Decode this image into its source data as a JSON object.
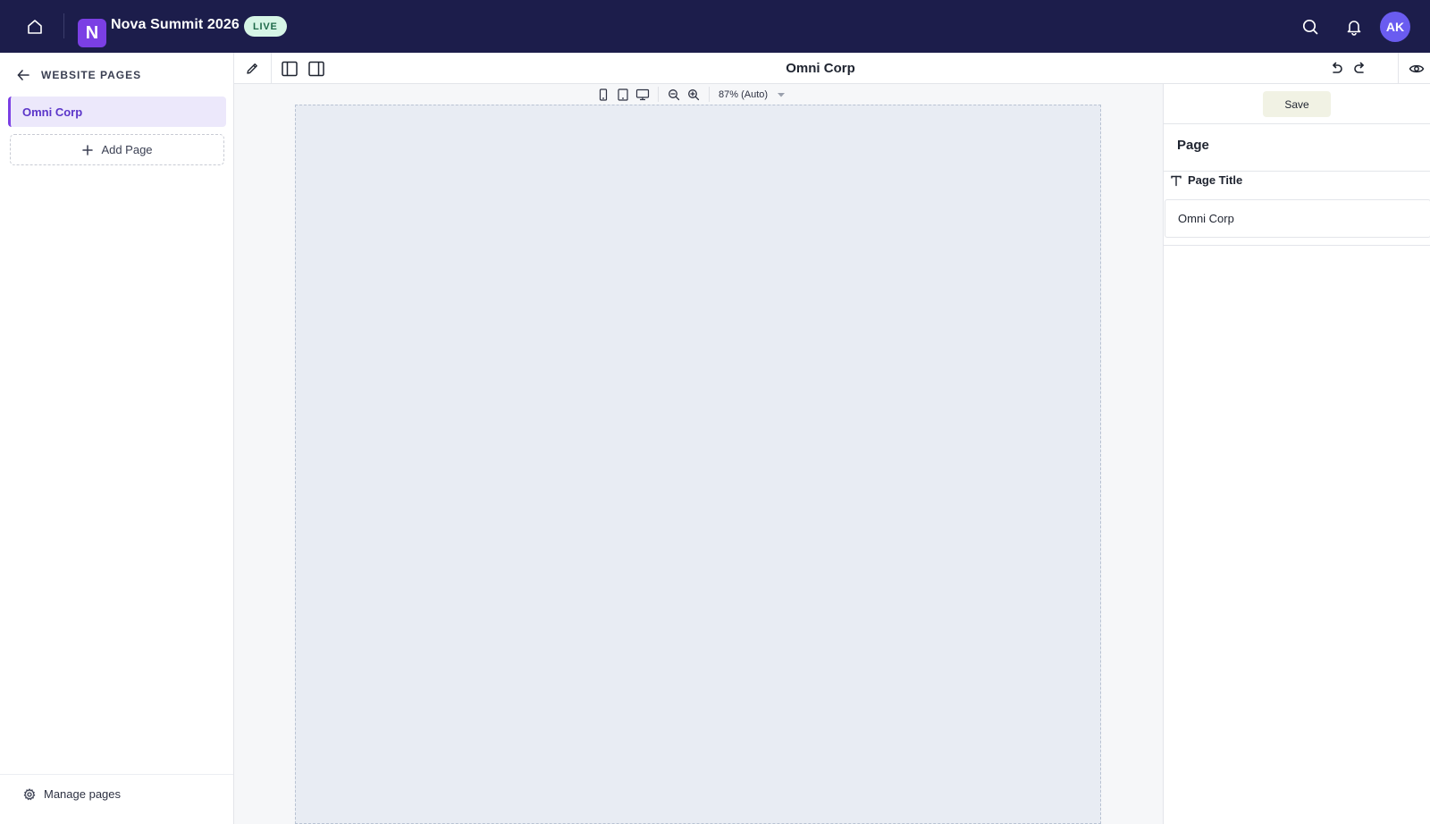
{
  "topbar": {
    "app_logo_letter": "N",
    "event_title": "Nova Summit 2026",
    "status_badge": "LIVE",
    "avatar_initials": "AK",
    "icons": [
      "home-icon",
      "search-icon",
      "bell-icon"
    ]
  },
  "sidebar": {
    "header_label": "WEBSITE PAGES",
    "pages": [
      {
        "label": "Omni Corp",
        "active": true
      }
    ],
    "add_page_label": "Add Page",
    "manage_pages_label": "Manage pages"
  },
  "toolbar": {
    "page_title": "Omni Corp",
    "icons": [
      "pencil-icon",
      "left-panel-icon",
      "right-panel-icon",
      "undo-icon",
      "redo-icon",
      "eye-icon"
    ]
  },
  "viewbar": {
    "devices": [
      "mobile-icon",
      "tablet-icon",
      "desktop-icon"
    ],
    "zoom_label": "87% (Auto)"
  },
  "right_panel": {
    "save_label": "Save",
    "section_heading": "Page",
    "field_label": "Page Title",
    "field_value": "Omni Corp"
  },
  "colors": {
    "topbar_bg": "#1c1d4b",
    "accent": "#7b3fe4",
    "live_badge_bg": "#d6f5e6",
    "avatar_bg": "#6a5cf0",
    "canvas_bg": "#e8ecf3"
  }
}
